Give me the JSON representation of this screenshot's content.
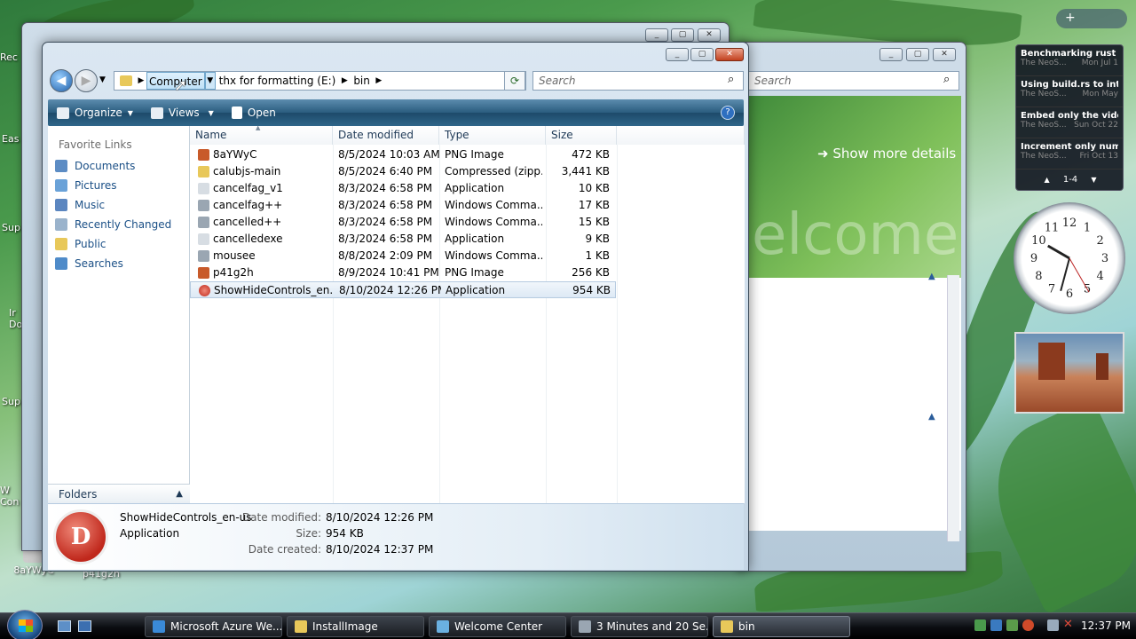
{
  "colors": {
    "accent": "#1d5ea8",
    "toolbar": "#2a5c7e",
    "link": "#1a4f86",
    "selected_row": "#dde9f5"
  },
  "desktop": {
    "icons": [
      {
        "label": "Rec"
      },
      {
        "label": "Eas"
      },
      {
        "label": "Sup"
      },
      {
        "label": "Ir Do"
      },
      {
        "label": "Sup"
      },
      {
        "label": "W Con"
      },
      {
        "label": "8aYWyC"
      },
      {
        "label": "p41g2h"
      }
    ]
  },
  "back_window_welcome": {
    "search_placeholder": "Search",
    "link": "Show more details",
    "banner": "elcome"
  },
  "explorer": {
    "address": {
      "segments": [
        "Computer",
        "thx for formatting (E:)",
        "bin"
      ]
    },
    "search_placeholder": "Search",
    "toolbar": {
      "organize": "Organize",
      "views": "Views",
      "open": "Open"
    },
    "favorite_links": {
      "title": "Favorite Links",
      "items": [
        "Documents",
        "Pictures",
        "Music",
        "Recently Changed",
        "Public",
        "Searches"
      ]
    },
    "folders_label": "Folders",
    "columns": [
      "Name",
      "Date modified",
      "Type",
      "Size"
    ],
    "files": [
      {
        "name": "8aYWyC",
        "date": "8/5/2024 10:03 AM",
        "type": "PNG Image",
        "size": "472 KB",
        "icon": "png-icon"
      },
      {
        "name": "calubjs-main",
        "date": "8/5/2024 6:40 PM",
        "type": "Compressed (zipp...",
        "size": "3,441 KB",
        "icon": "zip-icon"
      },
      {
        "name": "cancelfag_v1",
        "date": "8/3/2024 6:58 PM",
        "type": "Application",
        "size": "10 KB",
        "icon": "app-icon"
      },
      {
        "name": "cancelfag++",
        "date": "8/3/2024 6:58 PM",
        "type": "Windows Comma...",
        "size": "17 KB",
        "icon": "cmd-icon"
      },
      {
        "name": "cancelled++",
        "date": "8/3/2024 6:58 PM",
        "type": "Windows Comma...",
        "size": "15 KB",
        "icon": "cmd-icon"
      },
      {
        "name": "cancelledexe",
        "date": "8/3/2024 6:58 PM",
        "type": "Application",
        "size": "9 KB",
        "icon": "app-icon"
      },
      {
        "name": "mousee",
        "date": "8/8/2024 2:09 PM",
        "type": "Windows Comma...",
        "size": "1 KB",
        "icon": "cmd-icon"
      },
      {
        "name": "p41g2h",
        "date": "8/9/2024 10:41 PM",
        "type": "PNG Image",
        "size": "256 KB",
        "icon": "png-icon"
      },
      {
        "name": "ShowHideControls_en...",
        "date": "8/10/2024 12:26 PM",
        "type": "Application",
        "size": "954 KB",
        "icon": "app-icon",
        "selected": true
      }
    ],
    "details": {
      "name": "ShowHideControls_en-us",
      "kind": "Application",
      "date_modified_label": "Date modified:",
      "date_modified": "8/10/2024 12:26 PM",
      "size_label": "Size:",
      "size": "954 KB",
      "date_created_label": "Date created:",
      "date_created": "8/10/2024 12:37 PM"
    }
  },
  "gadgets": {
    "feeds": [
      {
        "title": "Benchmarking rust c...",
        "source": "The NeoS...",
        "date": "Mon Jul 1"
      },
      {
        "title": "Using build.rs to inte...",
        "source": "The NeoS...",
        "date": "Mon May"
      },
      {
        "title": "Embed only the vide...",
        "source": "The NeoS...",
        "date": "Sun Oct 22"
      },
      {
        "title": "Increment only num...",
        "source": "The NeoS...",
        "date": "Fri Oct 13"
      }
    ],
    "feed_page": "1-4",
    "clock_numbers": [
      "12",
      "1",
      "2",
      "3",
      "4",
      "5",
      "6",
      "7",
      "8",
      "9",
      "10",
      "11"
    ]
  },
  "taskbar": {
    "tasks": [
      {
        "label": "Microsoft Azure We...",
        "icon": "ie-icon"
      },
      {
        "label": "InstallImage",
        "icon": "folder-icon"
      },
      {
        "label": "Welcome Center",
        "icon": "doc-icon"
      },
      {
        "label": "3 Minutes and 20 Se...",
        "icon": "cmd-icon"
      },
      {
        "label": "bin",
        "icon": "folder-icon",
        "active": true
      }
    ],
    "time": "12:37 PM"
  }
}
